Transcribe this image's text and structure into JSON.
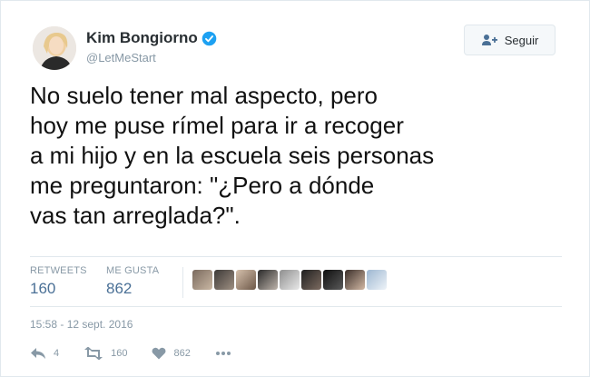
{
  "user": {
    "name": "Kim Bongiorno",
    "handle": "@LetMeStart",
    "verified": true,
    "avatar_icon": "user-avatar-photo"
  },
  "follow_button": {
    "label": "Seguir",
    "icon": "add-user-icon"
  },
  "tweet": {
    "lines": [
      "No suelo tener mal aspecto, pero",
      "hoy me puse rímel para ir a recoger",
      "a mi hijo y en la escuela seis personas",
      "me preguntaron: \"¿Pero a dónde",
      "vas tan arreglada?\"."
    ]
  },
  "stats": {
    "retweets_label": "RETWEETS",
    "retweets_value": "160",
    "likes_label": "ME GUSTA",
    "likes_value": "862"
  },
  "likers": [
    "liker-avatar-1",
    "liker-avatar-2",
    "liker-avatar-3",
    "liker-avatar-4",
    "liker-avatar-5",
    "liker-avatar-6",
    "liker-avatar-7",
    "liker-avatar-8",
    "liker-avatar-9"
  ],
  "timestamp": "15:58 - 12 sept. 2016",
  "actions": {
    "reply_count": "4",
    "retweet_count": "160",
    "like_count": "862"
  },
  "colors": {
    "accent": "#4a7096",
    "muted": "#8899a6",
    "verified": "#1da1f2",
    "border": "#e1e8ed"
  }
}
